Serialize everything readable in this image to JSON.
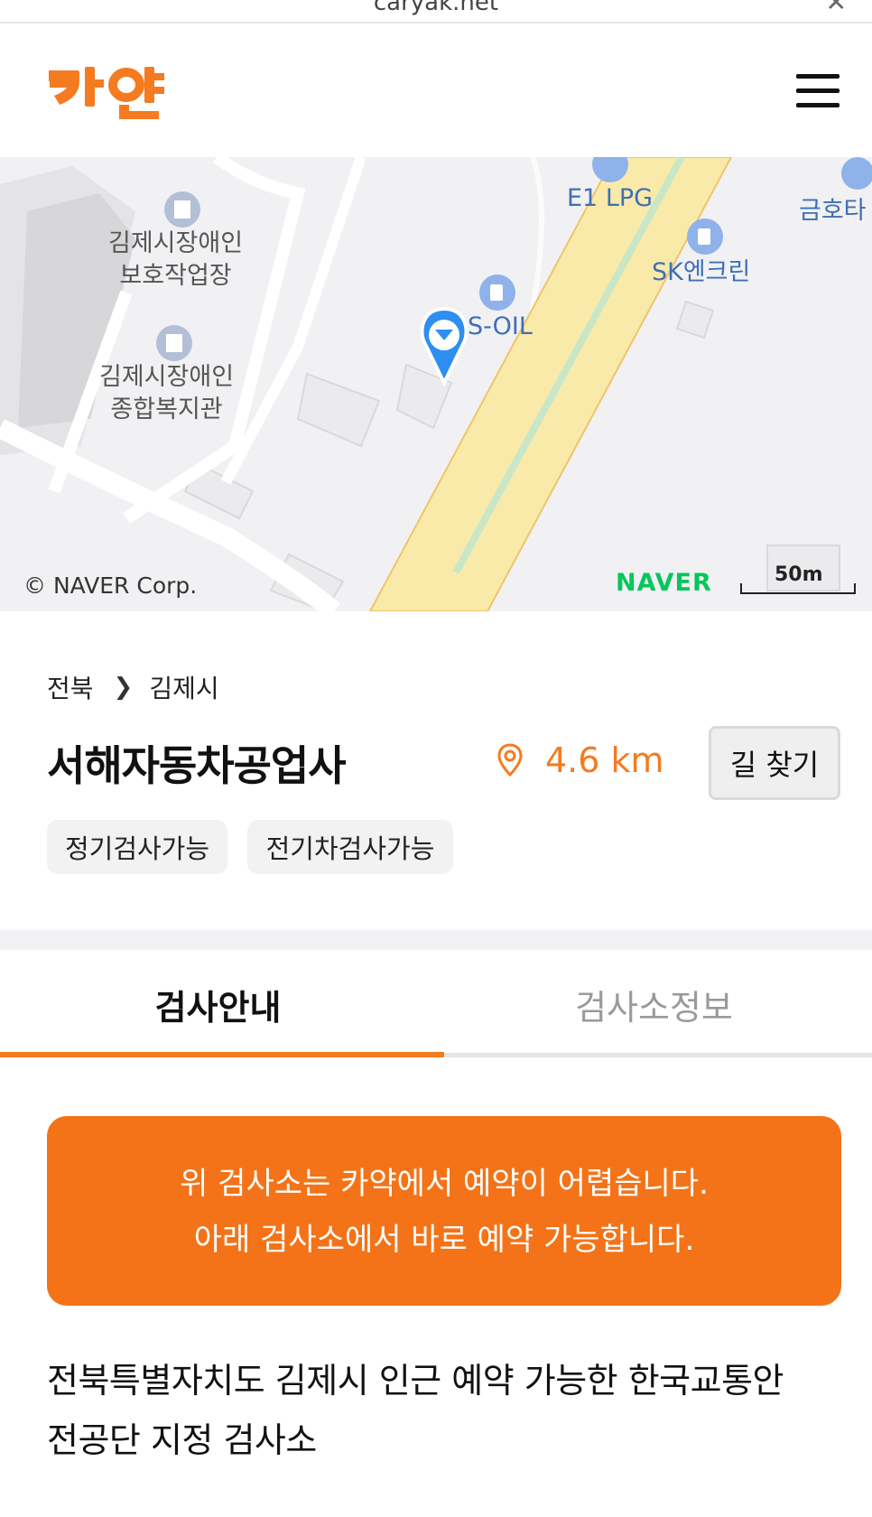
{
  "browser": {
    "url": "caryak.net",
    "close_icon": "close-icon"
  },
  "header": {
    "logo_text": "카약",
    "menu_icon": "hamburger-icon",
    "brand_color": "#f47b20"
  },
  "map": {
    "pois": {
      "lpg": "E1 LPG",
      "sk": "SK엔크린",
      "kumho": "금호타",
      "soil": "S-OIL",
      "center1_line1": "김제시장애인",
      "center1_line2": "보호작업장",
      "center2_line1": "김제시장애인",
      "center2_line2": "종합복지관"
    },
    "copyright": "© NAVER Corp.",
    "provider": "NAVER",
    "scale": "50m"
  },
  "info": {
    "breadcrumb": {
      "region": "전북",
      "city": "김제시"
    },
    "name": "서해자동차공업사",
    "distance": "4.6 km",
    "route_button": "길 찾기",
    "tags": [
      "정기검사가능",
      "전기차검사가능"
    ],
    "accent_color": "#f47b20"
  },
  "tabs": [
    {
      "label": "검사안내",
      "active": true
    },
    {
      "label": "검사소정보",
      "active": false
    }
  ],
  "notice": {
    "line1": "위 검사소는 카약에서 예약이 어렵습니다.",
    "line2": "아래 검사소에서 바로 예약 가능합니다."
  },
  "section": {
    "line1": "전북특별자치도 김제시 인근 예약 가능한 한국교통안",
    "line2": "전공단 지정 검사소"
  }
}
